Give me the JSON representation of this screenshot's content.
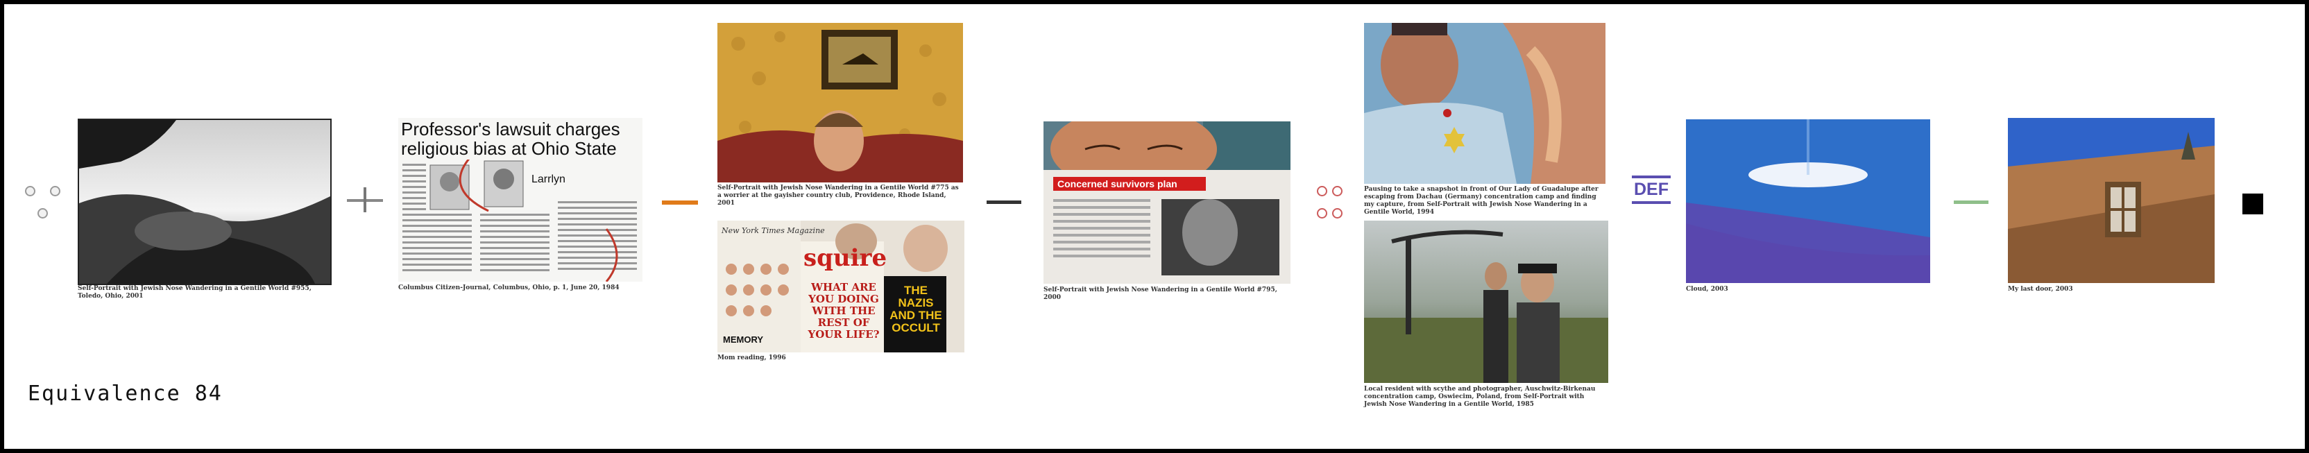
{
  "page": {
    "title": "Equivalence 84"
  },
  "photos": [
    {
      "id": "p1",
      "caption": "Self-Portrait with Jewish Nose Wandering in a Gentile World #955, Toledo, Ohio, 2001"
    },
    {
      "id": "p2",
      "headline": "Professor's lawsuit charges religious bias at Ohio State",
      "name_tag": "Larrlyn",
      "caption": "Columbus Citizen-Journal, Columbus, Ohio, p. 1, June 20, 1984"
    },
    {
      "id": "p3",
      "caption": "Self-Portrait with Jewish Nose Wandering in a Gentile World #775 as a worrier at the gayisher country club, Providence, Rhode Island, 2001"
    },
    {
      "id": "p4",
      "magazine": "squire",
      "cover_lines": [
        "WHAT ARE YOU DOING WITH THE REST OF YOUR LIFE?"
      ],
      "book_title": "THE NAZIS AND THE OCCULT",
      "mem_label": "MEMORY",
      "caption": "Mom reading, 1996"
    },
    {
      "id": "p5",
      "caption": "Self-Portrait with Jewish Nose Wandering in a Gentile World #795, 2000"
    },
    {
      "id": "p6",
      "caption": "Pausing to take a snapshot in front of Our Lady of Guadalupe after escaping from Dachau (Germany) concentration camp and finding my capture, from Self-Portrait with Jewish Nose Wandering in a Gentile World, 1994"
    },
    {
      "id": "p7",
      "caption": "Local resident with scythe and photographer, Auschwitz-Birkenau concentration camp, Oswiecim, Poland, from Self-Portrait with Jewish Nose Wandering in a Gentile World, 1985"
    },
    {
      "id": "p8",
      "caption": "Cloud, 2003"
    },
    {
      "id": "p9",
      "caption": "My last door, 2003"
    }
  ],
  "def_label": "DEF",
  "colors": {
    "frame": "#000000",
    "accent": "#5a4eb0",
    "red_dot": "#cc5b5b",
    "grey_dot": "#9a9a9a"
  }
}
